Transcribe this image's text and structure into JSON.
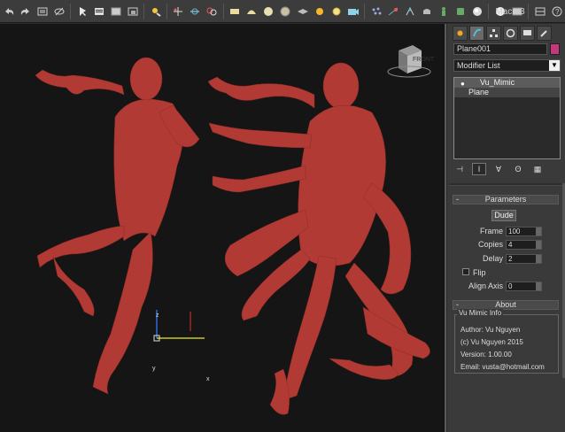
{
  "toolbar": {
    "icons": [
      "undo-icon",
      "redo-icon",
      "select-link-icon",
      "unlink-icon",
      "bind-spacewarp-icon",
      "select-icon",
      "select-by-name-icon",
      "rect-select-icon",
      "window-crossing-icon",
      "move-icon",
      "rotate-icon",
      "scale-icon",
      "snap-icon",
      "angle-snap-icon",
      "percent-snap-icon",
      "spinner-snap-icon",
      "edit-named-sets-icon",
      "mirror-icon",
      "align-icon",
      "layer-icon",
      "graphite-icon",
      "curve-editor-icon",
      "schematic-icon",
      "material-editor-icon",
      "render-setup-icon",
      "render-frame-icon",
      "render-icon",
      "help-icon"
    ],
    "macro_label": "Macro3"
  },
  "viewport": {
    "viewcube_label": "FRONT",
    "gizmo_x": "x",
    "gizmo_y": "y",
    "gizmo_z": "z",
    "figure_color": "#b23a34"
  },
  "panel": {
    "tabs": [
      "create-tab-icon",
      "modify-tab-icon",
      "hierarchy-tab-icon",
      "motion-tab-icon",
      "display-tab-icon",
      "utilities-tab-icon"
    ],
    "object_name": "Plane001",
    "object_color": "#c23a7c",
    "modifier_list": "Modifier List",
    "stack": [
      {
        "label": "Vu_Mimic",
        "selected": true
      },
      {
        "label": "Plane",
        "selected": false
      }
    ],
    "parameters": {
      "title": "Parameters",
      "dude_button": "Dude",
      "frame_label": "Frame",
      "frame_value": "100",
      "copies_label": "Copies",
      "copies_value": "4",
      "delay_label": "Delay",
      "delay_value": "2",
      "flip_label": "Flip",
      "align_axis_label": "Align Axis",
      "align_axis_value": "0"
    },
    "about": {
      "title": "About",
      "group_title": "Vu Mimic Info",
      "author": "Author: Vu Nguyen",
      "copyright": "(c) Vu Nguyen 2015",
      "version": "Version: 1.00.00",
      "email": "Email: vusta@hotmail.com"
    }
  }
}
